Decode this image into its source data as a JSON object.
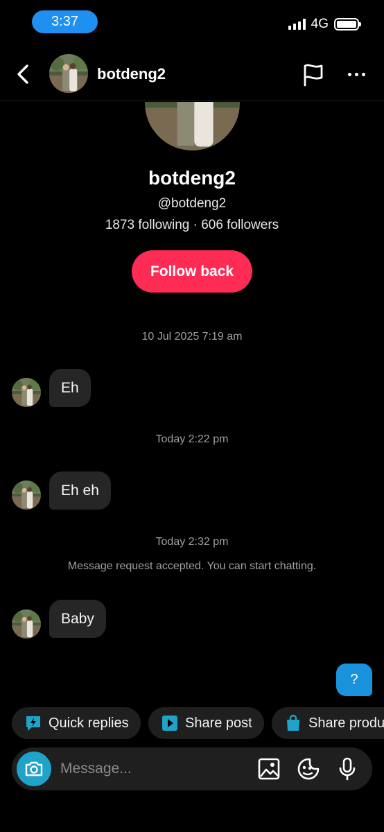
{
  "status_bar": {
    "time": "3:37",
    "network": "4G"
  },
  "header": {
    "username": "botdeng2"
  },
  "profile": {
    "name": "botdeng2",
    "handle": "@botdeng2",
    "stats": "1873 following · 606 followers",
    "follow_label": "Follow back"
  },
  "conversation": {
    "ts1": "10 Jul 2025 7:19 am",
    "msg1": "Eh",
    "ts2": "Today 2:22 pm",
    "msg2": "Eh eh",
    "ts3": "Today 2:32 pm",
    "system_msg": "Message request accepted. You can start chatting.",
    "msg3": "Baby",
    "outgoing": "?"
  },
  "quick_actions": [
    {
      "label": "Quick replies",
      "icon": "lightning-chat-icon"
    },
    {
      "label": "Share post",
      "icon": "play-square-icon"
    },
    {
      "label": "Share product",
      "icon": "shopping-bag-icon"
    }
  ],
  "composer": {
    "placeholder": "Message..."
  },
  "colors": {
    "accent": "#fe2c55",
    "outgoing_bubble": "#1a93dd",
    "camera": "#1fa3c9",
    "status_pill": "#1f8ff0"
  }
}
